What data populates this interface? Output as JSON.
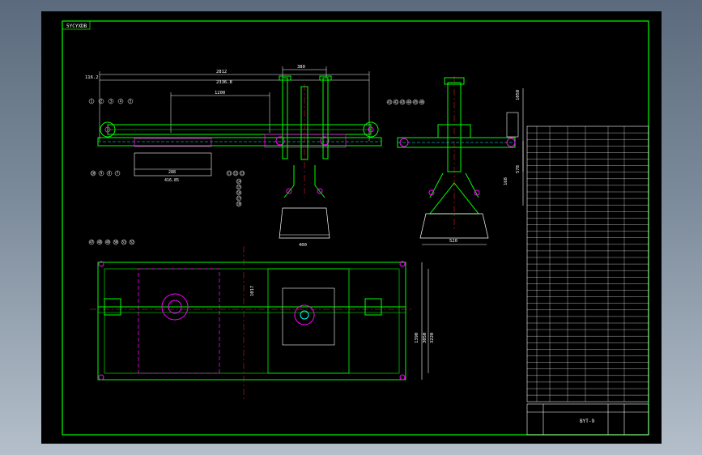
{
  "drawing": {
    "tag": "5YCYXDB",
    "colors": {
      "background": "#000000",
      "frame": "#00ff00",
      "part": "#00ff00",
      "dimension": "#ffffff",
      "highlight": "#ff00ff",
      "centerline": "#ff2020",
      "cyan": "#00ffff",
      "yellow": "#ffff00"
    },
    "front_view": {
      "dims": {
        "overall": "2812",
        "left": "116.2",
        "span": "2336.8",
        "inner": "1200",
        "top": "380",
        "bottom": "288",
        "base_width": "416.85",
        "hopper": "400"
      },
      "balloons_left": [
        "1",
        "2",
        "3",
        "4",
        "5"
      ],
      "balloons_bottom_left": [
        "10",
        "9",
        "8",
        "7"
      ],
      "balloons_mid": [
        "11",
        "12",
        "13"
      ],
      "balloons_lower": [
        "14",
        "15",
        "16",
        "17",
        "18"
      ]
    },
    "side_view": {
      "dims": {
        "height": "1050",
        "mid": "578",
        "low": "168",
        "width": "520"
      },
      "balloons": [
        "41",
        "42",
        "43",
        "44",
        "45",
        "46"
      ]
    },
    "plan_view": {
      "dims": {
        "length": "3050",
        "width": "1390",
        "inner": "3220",
        "off": "1017"
      },
      "balloons": [
        "47",
        "48",
        "49",
        "50",
        "51",
        "52"
      ]
    },
    "title_block": {
      "title": "BYT-9"
    }
  }
}
